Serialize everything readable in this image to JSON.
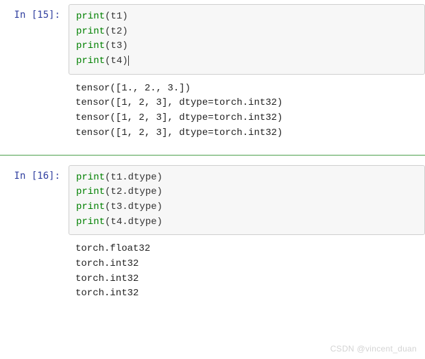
{
  "cells": [
    {
      "prompt_label": "In ",
      "prompt_num": "[15]:",
      "input_lines": [
        {
          "func": "print",
          "open": "(",
          "arg": "t1",
          "close": ")",
          "cursor": false
        },
        {
          "func": "print",
          "open": "(",
          "arg": "t2",
          "close": ")",
          "cursor": false
        },
        {
          "func": "print",
          "open": "(",
          "arg": "t3",
          "close": ")",
          "cursor": false
        },
        {
          "func": "print",
          "open": "(",
          "arg": "t4",
          "close": ")",
          "cursor": true
        }
      ],
      "output_lines": [
        "tensor([1., 2., 3.])",
        "tensor([1, 2, 3], dtype=torch.int32)",
        "tensor([1, 2, 3], dtype=torch.int32)",
        "tensor([1, 2, 3], dtype=torch.int32)"
      ]
    },
    {
      "prompt_label": "In ",
      "prompt_num": "[16]:",
      "input_lines": [
        {
          "func": "print",
          "open": "(",
          "arg": "t1.dtype",
          "close": ")",
          "cursor": false
        },
        {
          "func": "print",
          "open": "(",
          "arg": "t2.dtype",
          "close": ")",
          "cursor": false
        },
        {
          "func": "print",
          "open": "(",
          "arg": "t3.dtype",
          "close": ")",
          "cursor": false
        },
        {
          "func": "print",
          "open": "(",
          "arg": "t4.dtype",
          "close": ")",
          "cursor": false
        }
      ],
      "output_lines": [
        "torch.float32",
        "torch.int32",
        "torch.int32",
        "torch.int32"
      ]
    }
  ],
  "watermark": "CSDN @vincent_duan"
}
